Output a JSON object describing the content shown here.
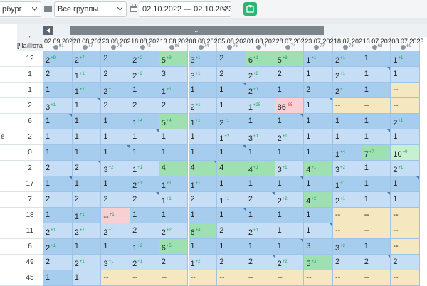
{
  "toolbar": {
    "city_value": "рбург",
    "group_value": "Все группы",
    "date_range_value": "02.10.2022 — 02.10.2023",
    "export_icon": "excel-export-icon"
  },
  "grid": {
    "range_bar_label": "...",
    "freq_header": "\"[Частота]\"",
    "left_labels": [
      "",
      "",
      "",
      "",
      "",
      "е",
      "",
      "",
      "",
      "",
      "",
      "",
      "",
      ""
    ],
    "freq_values": [
      "12",
      "1",
      "1",
      "2",
      "6",
      "2",
      "0",
      "2",
      "17",
      "7",
      "18",
      "11",
      "6",
      "49",
      "45"
    ],
    "columns": [
      {
        "date": "02.09.2023",
        "num": "91"
      },
      {
        "date": "28.08.2023",
        "num": "77"
      },
      {
        "date": "23.08.2023",
        "num": "73"
      },
      {
        "date": "18.08.2023",
        "num": "72"
      },
      {
        "date": "13.08.2023",
        "num": "86"
      },
      {
        "date": "08.08.2023",
        "num": "74"
      },
      {
        "date": "05.08.2023",
        "num": "75"
      },
      {
        "date": "01.08.2023",
        "num": "74"
      },
      {
        "date": "28.07.2023",
        "num": "74"
      },
      {
        "date": "23.07.2023",
        "num": "77"
      },
      {
        "date": "18.07.2023",
        "num": "73"
      },
      {
        "date": "13.07.2023",
        "num": "68"
      },
      {
        "date": "08.07.2023",
        "num": "60"
      }
    ],
    "rows": [
      [
        {
          "v": "2",
          "d": "+9",
          "c": "a"
        },
        {
          "v": "2",
          "d": "+7",
          "c": "a"
        },
        {
          "v": "2",
          "d": "",
          "c": "a"
        },
        {
          "v": "2",
          "d": "+2",
          "c": "a"
        },
        {
          "v": "5",
          "d": "+3",
          "c": "g"
        },
        {
          "v": "3",
          "d": "+1",
          "c": "a"
        },
        {
          "v": "2",
          "d": "",
          "c": "a"
        },
        {
          "v": "6",
          "d": "+1",
          "c": "g"
        },
        {
          "v": "5",
          "d": "+8",
          "c": "g"
        },
        {
          "v": "1",
          "d": "+1",
          "c": "a"
        },
        {
          "v": "2",
          "d": "+1",
          "c": "a"
        },
        {
          "v": "1",
          "d": "",
          "c": "a"
        },
        {
          "v": "1",
          "d": "+1",
          "c": "a"
        }
      ],
      [
        {
          "v": "2",
          "d": "",
          "c": "b"
        },
        {
          "v": "1",
          "d": "+1",
          "c": "b"
        },
        {
          "v": "2",
          "d": "",
          "c": "b"
        },
        {
          "v": "2",
          "d": "+2",
          "c": "b"
        },
        {
          "v": "3",
          "d": "",
          "c": "b"
        },
        {
          "v": "3",
          "d": "+1",
          "c": "b"
        },
        {
          "v": "2",
          "d": "",
          "c": "b"
        },
        {
          "v": "2",
          "d": "+2",
          "c": "b"
        },
        {
          "v": "2",
          "d": "",
          "c": "b"
        },
        {
          "v": "1",
          "d": "",
          "c": "b"
        },
        {
          "v": "2",
          "d": "+1",
          "c": "b"
        },
        {
          "v": "1",
          "d": "",
          "c": "b"
        },
        {
          "v": "1",
          "d": "",
          "c": "b"
        }
      ],
      [
        {
          "v": "1",
          "d": "",
          "c": "a"
        },
        {
          "v": "1",
          "d": "+1",
          "c": "a"
        },
        {
          "v": "2",
          "d": "+1",
          "c": "a"
        },
        {
          "v": "1",
          "d": "",
          "c": "a"
        },
        {
          "v": "1",
          "d": "+1",
          "c": "a"
        },
        {
          "v": "1",
          "d": "",
          "c": "a"
        },
        {
          "v": "1",
          "d": "",
          "c": "a"
        },
        {
          "v": "2",
          "d": "+1",
          "c": "a"
        },
        {
          "v": "1",
          "d": "",
          "c": "a"
        },
        {
          "v": "2",
          "d": "",
          "c": "a"
        },
        {
          "v": "2",
          "d": "+1",
          "c": "a"
        },
        {
          "v": "1",
          "d": "",
          "c": "a"
        },
        {
          "v": "--",
          "d": "",
          "c": "y"
        }
      ],
      [
        {
          "v": "3",
          "d": "+1",
          "c": "b"
        },
        {
          "v": "1",
          "d": "",
          "c": "b"
        },
        {
          "v": "2",
          "d": "",
          "c": "b"
        },
        {
          "v": "2",
          "d": "",
          "c": "b"
        },
        {
          "v": "2",
          "d": "",
          "c": "b"
        },
        {
          "v": "2",
          "d": "+1",
          "c": "b"
        },
        {
          "v": "1",
          "d": "",
          "c": "b"
        },
        {
          "v": "1",
          "d": "+25",
          "c": "b"
        },
        {
          "v": "86",
          "d": "-85",
          "c": "r"
        },
        {
          "v": "1",
          "d": "",
          "c": "b"
        },
        {
          "v": "--",
          "d": "",
          "c": "y"
        },
        {
          "v": "--",
          "d": "",
          "c": "y"
        },
        {
          "v": "--",
          "d": "",
          "c": "y"
        }
      ],
      [
        {
          "v": "1",
          "d": "",
          "c": "a"
        },
        {
          "v": "1",
          "d": "",
          "c": "a"
        },
        {
          "v": "1",
          "d": "",
          "c": "a"
        },
        {
          "v": "1",
          "d": "+4",
          "c": "a"
        },
        {
          "v": "5",
          "d": "+4",
          "c": "g"
        },
        {
          "v": "1",
          "d": "+1",
          "c": "a"
        },
        {
          "v": "2",
          "d": "+1",
          "c": "a"
        },
        {
          "v": "1",
          "d": "",
          "c": "a"
        },
        {
          "v": "1",
          "d": "",
          "c": "a"
        },
        {
          "v": "1",
          "d": "",
          "c": "a"
        },
        {
          "v": "1",
          "d": "",
          "c": "a"
        },
        {
          "v": "1",
          "d": "",
          "c": "a"
        },
        {
          "v": "2",
          "d": "+1",
          "c": "a"
        }
      ],
      [
        {
          "v": "1",
          "d": "",
          "c": "b"
        },
        {
          "v": "1",
          "d": "",
          "c": "b"
        },
        {
          "v": "1",
          "d": "",
          "c": "b"
        },
        {
          "v": "1",
          "d": "",
          "c": "b"
        },
        {
          "v": "1",
          "d": "",
          "c": "b"
        },
        {
          "v": "1",
          "d": "",
          "c": "b"
        },
        {
          "v": "1",
          "d": "+2",
          "c": "b"
        },
        {
          "v": "3",
          "d": "+1",
          "c": "b"
        },
        {
          "v": "2",
          "d": "+1",
          "c": "b"
        },
        {
          "v": "1",
          "d": "",
          "c": "b"
        },
        {
          "v": "1",
          "d": "",
          "c": "b"
        },
        {
          "v": "1",
          "d": "",
          "c": "b"
        },
        {
          "v": "1",
          "d": "",
          "c": "b"
        }
      ],
      [
        {
          "v": "1",
          "d": "",
          "c": "a"
        },
        {
          "v": "1",
          "d": "",
          "c": "a"
        },
        {
          "v": "1",
          "d": "",
          "c": "a"
        },
        {
          "v": "1",
          "d": "",
          "c": "a"
        },
        {
          "v": "1",
          "d": "",
          "c": "a"
        },
        {
          "v": "1",
          "d": "",
          "c": "a"
        },
        {
          "v": "1",
          "d": "",
          "c": "a"
        },
        {
          "v": "1",
          "d": "",
          "c": "a"
        },
        {
          "v": "1",
          "d": "",
          "c": "a"
        },
        {
          "v": "1",
          "d": "",
          "c": "a"
        },
        {
          "v": "1",
          "d": "+4",
          "c": "a"
        },
        {
          "v": "7",
          "d": "+7",
          "c": "g"
        },
        {
          "v": "10",
          "d": "+9",
          "c": "gl"
        }
      ],
      [
        {
          "v": "2",
          "d": "",
          "c": "b"
        },
        {
          "v": "2",
          "d": "",
          "c": "b"
        },
        {
          "v": "3",
          "d": "+2",
          "c": "b"
        },
        {
          "v": "1",
          "d": "+1",
          "c": "b"
        },
        {
          "v": "4",
          "d": "",
          "c": "g"
        },
        {
          "v": "4",
          "d": "",
          "c": "g"
        },
        {
          "v": "4",
          "d": "",
          "c": "g"
        },
        {
          "v": "4",
          "d": "+1",
          "c": "g"
        },
        {
          "v": "3",
          "d": "+1",
          "c": "b"
        },
        {
          "v": "4",
          "d": "+1",
          "c": "g"
        },
        {
          "v": "3",
          "d": "+2",
          "c": "b"
        },
        {
          "v": "1",
          "d": "",
          "c": "b"
        },
        {
          "v": "2",
          "d": "+1",
          "c": "b"
        }
      ],
      [
        {
          "v": "1",
          "d": "",
          "c": "a"
        },
        {
          "v": "1",
          "d": "",
          "c": "a"
        },
        {
          "v": "1",
          "d": "",
          "c": "a"
        },
        {
          "v": "2",
          "d": "+1",
          "c": "a"
        },
        {
          "v": "1",
          "d": "+1",
          "c": "a"
        },
        {
          "v": "1",
          "d": "+1",
          "c": "a"
        },
        {
          "v": "1",
          "d": "",
          "c": "a"
        },
        {
          "v": "1",
          "d": "",
          "c": "a"
        },
        {
          "v": "1",
          "d": "",
          "c": "a"
        },
        {
          "v": "1",
          "d": "",
          "c": "a"
        },
        {
          "v": "1",
          "d": "+1",
          "c": "a"
        },
        {
          "v": "1",
          "d": "",
          "c": "a"
        },
        {
          "v": "1",
          "d": "",
          "c": "a"
        }
      ],
      [
        {
          "v": "2",
          "d": "",
          "c": "b"
        },
        {
          "v": "2",
          "d": "",
          "c": "b"
        },
        {
          "v": "2",
          "d": "",
          "c": "b"
        },
        {
          "v": "2",
          "d": "",
          "c": "b"
        },
        {
          "v": "1",
          "d": "+1",
          "c": "b"
        },
        {
          "v": "2",
          "d": "",
          "c": "b"
        },
        {
          "v": "1",
          "d": "+1",
          "c": "b"
        },
        {
          "v": "2",
          "d": "",
          "c": "b"
        },
        {
          "v": "2",
          "d": "+2",
          "c": "b"
        },
        {
          "v": "4",
          "d": "+2",
          "c": "g"
        },
        {
          "v": "2",
          "d": "+1",
          "c": "b"
        },
        {
          "v": "1",
          "d": "",
          "c": "b"
        },
        {
          "v": "1",
          "d": "",
          "c": "b"
        }
      ],
      [
        {
          "v": "1",
          "d": "",
          "c": "a"
        },
        {
          "v": "1",
          "d": "+1",
          "c": "a"
        },
        {
          "v": "--",
          "d": "+1",
          "c": "r"
        },
        {
          "v": "1",
          "d": "",
          "c": "a"
        },
        {
          "v": "1",
          "d": "",
          "c": "a"
        },
        {
          "v": "1",
          "d": "",
          "c": "a"
        },
        {
          "v": "1",
          "d": "",
          "c": "a"
        },
        {
          "v": "1",
          "d": "",
          "c": "a"
        },
        {
          "v": "1",
          "d": "",
          "c": "a"
        },
        {
          "v": "1",
          "d": "",
          "c": "a"
        },
        {
          "v": "--",
          "d": "",
          "c": "y"
        },
        {
          "v": "--",
          "d": "",
          "c": "y"
        },
        {
          "v": "--",
          "d": "",
          "c": "y"
        }
      ],
      [
        {
          "v": "2",
          "d": "+1",
          "c": "b"
        },
        {
          "v": "2",
          "d": "+1",
          "c": "b"
        },
        {
          "v": "2",
          "d": "+1",
          "c": "b"
        },
        {
          "v": "2",
          "d": "",
          "c": "b"
        },
        {
          "v": "2",
          "d": "+2",
          "c": "b"
        },
        {
          "v": "6",
          "d": "+4",
          "c": "g"
        },
        {
          "v": "2",
          "d": "",
          "c": "b"
        },
        {
          "v": "2",
          "d": "+1",
          "c": "b"
        },
        {
          "v": "1",
          "d": "",
          "c": "b"
        },
        {
          "v": "1",
          "d": "",
          "c": "b"
        },
        {
          "v": "--",
          "d": "",
          "c": "y"
        },
        {
          "v": "--",
          "d": "",
          "c": "y"
        },
        {
          "v": "--",
          "d": "",
          "c": "y"
        }
      ],
      [
        {
          "v": "2",
          "d": "+1",
          "c": "a"
        },
        {
          "v": "1",
          "d": "",
          "c": "a"
        },
        {
          "v": "1",
          "d": "",
          "c": "a"
        },
        {
          "v": "1",
          "d": "+2",
          "c": "a"
        },
        {
          "v": "6",
          "d": "+5",
          "c": "g"
        },
        {
          "v": "1",
          "d": "",
          "c": "a"
        },
        {
          "v": "1",
          "d": "",
          "c": "a"
        },
        {
          "v": "1",
          "d": "",
          "c": "a"
        },
        {
          "v": "1",
          "d": "",
          "c": "a"
        },
        {
          "v": "3",
          "d": "",
          "c": "a"
        },
        {
          "v": "3",
          "d": "+2",
          "c": "a"
        },
        {
          "v": "1",
          "d": "",
          "c": "a"
        },
        {
          "v": "--",
          "d": "",
          "c": "y"
        }
      ],
      [
        {
          "v": "2",
          "d": "",
          "c": "b"
        },
        {
          "v": "2",
          "d": "+1",
          "c": "b"
        },
        {
          "v": "3",
          "d": "+1",
          "c": "b"
        },
        {
          "v": "2",
          "d": "+1",
          "c": "b"
        },
        {
          "v": "2",
          "d": "",
          "c": "b"
        },
        {
          "v": "1",
          "d": "+2",
          "c": "b"
        },
        {
          "v": "2",
          "d": "",
          "c": "b"
        },
        {
          "v": "2",
          "d": "",
          "c": "b"
        },
        {
          "v": "2",
          "d": "+2",
          "c": "b"
        },
        {
          "v": "5",
          "d": "+3",
          "c": "g"
        },
        {
          "v": "2",
          "d": "",
          "c": "b"
        },
        {
          "v": "2",
          "d": "",
          "c": "b"
        },
        {
          "v": "2",
          "d": "",
          "c": "b"
        }
      ],
      [
        {
          "v": "1",
          "d": "",
          "c": "a"
        },
        {
          "v": "1",
          "d": "",
          "c": "b"
        },
        {
          "v": "--",
          "d": "",
          "c": "y"
        },
        {
          "v": "--",
          "d": "",
          "c": "y"
        },
        {
          "v": "--",
          "d": "",
          "c": "y"
        },
        {
          "v": "--",
          "d": "",
          "c": "y"
        },
        {
          "v": "--",
          "d": "",
          "c": "y"
        },
        {
          "v": "--",
          "d": "",
          "c": "y"
        },
        {
          "v": "--",
          "d": "",
          "c": "y"
        },
        {
          "v": "--",
          "d": "",
          "c": "y"
        },
        {
          "v": "--",
          "d": "",
          "c": "y"
        },
        {
          "v": "--",
          "d": "",
          "c": "y"
        },
        {
          "v": "--",
          "d": "",
          "c": "y"
        }
      ]
    ]
  }
}
